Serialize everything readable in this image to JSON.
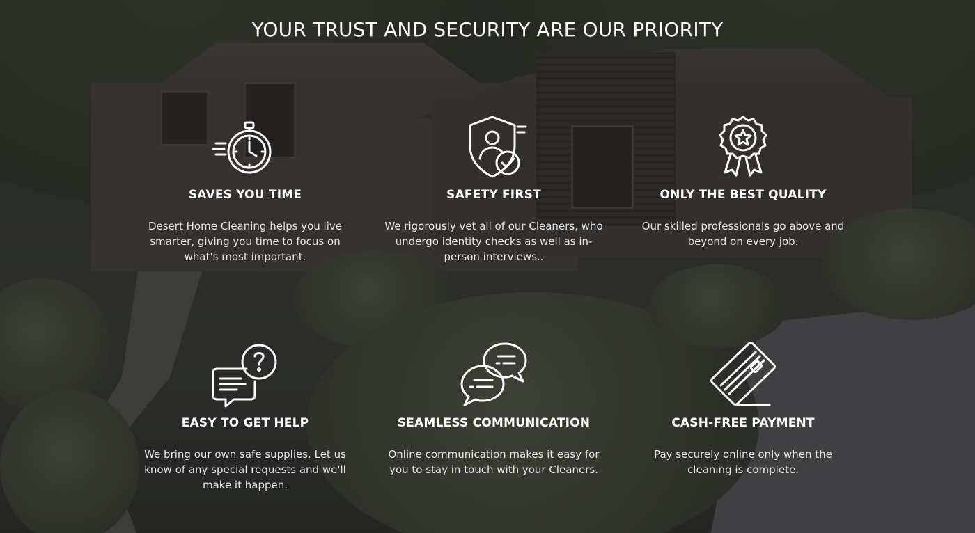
{
  "headline": "YOUR TRUST AND SECURITY ARE OUR PRIORITY",
  "features": [
    {
      "icon": "stopwatch-icon",
      "title": "SAVES YOU TIME",
      "description": "Desert Home Cleaning helps you live smarter, giving you time to focus on what's most important."
    },
    {
      "icon": "shield-person-check-icon",
      "title": "SAFETY FIRST",
      "description": "We rigorously vet all of our Cleaners, who undergo identity checks as well as in-person interviews.."
    },
    {
      "icon": "award-badge-icon",
      "title": "ONLY THE BEST QUALITY",
      "description": "Our skilled professionals go above and beyond on every job."
    },
    {
      "icon": "chat-question-icon",
      "title": "EASY TO GET HELP",
      "description": "We bring our own safe supplies. Let us know of any special requests and we'll make it happen."
    },
    {
      "icon": "chat-bubbles-icon",
      "title": "SEAMLESS COMMUNICATION",
      "description": "Online communication makes it easy for you to stay in touch with your Cleaners."
    },
    {
      "icon": "credit-card-icon",
      "title": "CASH-FREE PAYMENT",
      "description": "Pay securely online only when the cleaning is complete."
    }
  ],
  "colors": {
    "text": "#ffffff",
    "overlay": "#141414"
  }
}
